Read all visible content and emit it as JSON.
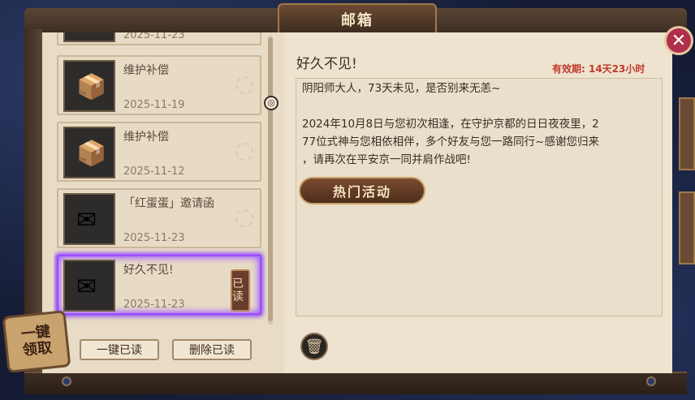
{
  "window": {
    "title": "邮箱"
  },
  "mail_list": [
    {
      "title": "",
      "date": "2025-11-23",
      "icon": "parcel-icon",
      "selected": false,
      "partial": true
    },
    {
      "title": "维护补偿",
      "date": "2025-11-19",
      "icon": "parcel-icon",
      "selected": false
    },
    {
      "title": "维护补偿",
      "date": "2025-11-12",
      "icon": "parcel-icon",
      "selected": false
    },
    {
      "title": "「红蛋蛋」邀请函",
      "date": "2025-11-23",
      "icon": "envelope-icon",
      "selected": false
    },
    {
      "title": "好久不见!",
      "date": "2025-11-23",
      "icon": "letter-icon",
      "selected": true,
      "status": "已读"
    }
  ],
  "buttons": {
    "collect_all": "一键\n领取",
    "read_all": "一键已读",
    "delete_read": "删除已读"
  },
  "detail": {
    "subject": "好久不见!",
    "validity": "有效期: 14天23小时",
    "body": "阴阳师大人，73天未见，是否别来无恙~\n\n2024年10月8日与您初次相逢，在守护京都的日日夜夜里，2\n77位式神与您相依相伴，多个好友与您一路同行~感谢您归来\n，请再次在平安京一同并肩作战吧!",
    "action_button": "热门活动"
  },
  "colors": {
    "accent": "#9a4cff",
    "validity": "#c0392b",
    "close": "#b0304a"
  }
}
